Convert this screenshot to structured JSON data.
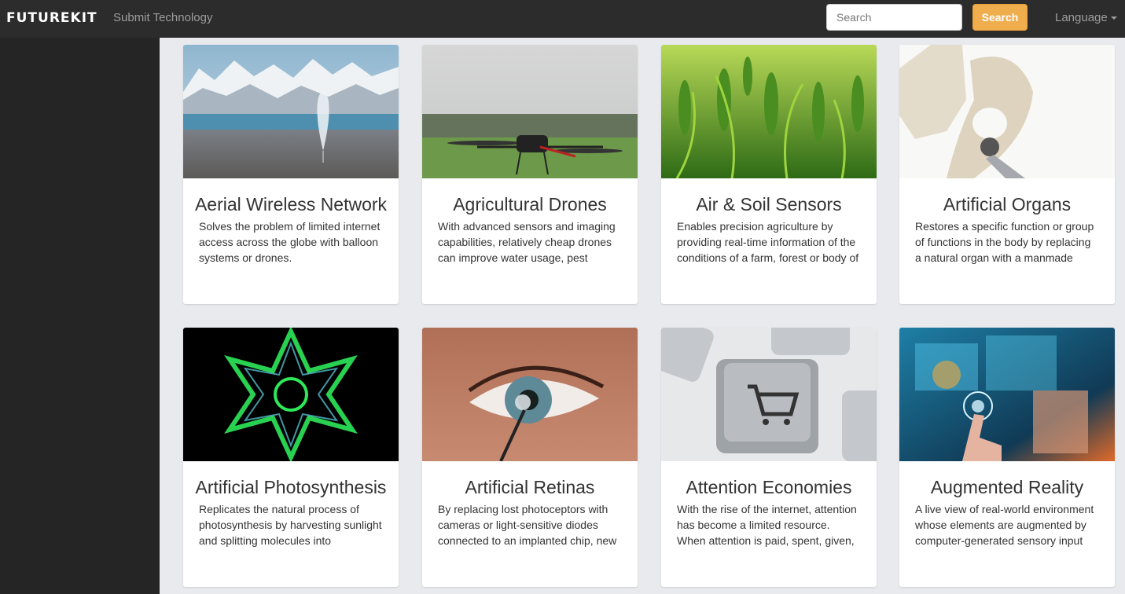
{
  "navbar": {
    "brand": "FUTUREKIT",
    "submit_link": "Submit Technology",
    "search_placeholder": "Search",
    "search_button": "Search",
    "language": "Language"
  },
  "cards": [
    {
      "title": "Aerial Wireless Network",
      "desc": "Solves the problem of limited internet access across the globe with balloon systems or drones."
    },
    {
      "title": "Agricultural Drones",
      "desc": "With advanced sensors and imaging capabilities, relatively cheap drones can improve water usage, pest"
    },
    {
      "title": "Air & Soil Sensors",
      "desc": "Enables precision agriculture by providing real-time information of the conditions of a farm, forest or body of"
    },
    {
      "title": "Artificial Organs",
      "desc": "Restores a specific function or group of functions in the body by replacing a natural organ with a manmade"
    },
    {
      "title": "Artificial Photosynthesis",
      "desc": "Replicates the natural process of photosynthesis by harvesting sunlight and splitting molecules into"
    },
    {
      "title": "Artificial Retinas",
      "desc": "By replacing lost photoceptors with cameras or light-sensitive diodes connected to an implanted chip, new"
    },
    {
      "title": "Attention Economies",
      "desc": "With the rise of the internet, attention has become a limited resource. When attention is paid, spent, given,"
    },
    {
      "title": "Augmented Reality",
      "desc": "A live view of real-world environment whose elements are augmented by computer-generated sensory input"
    }
  ]
}
